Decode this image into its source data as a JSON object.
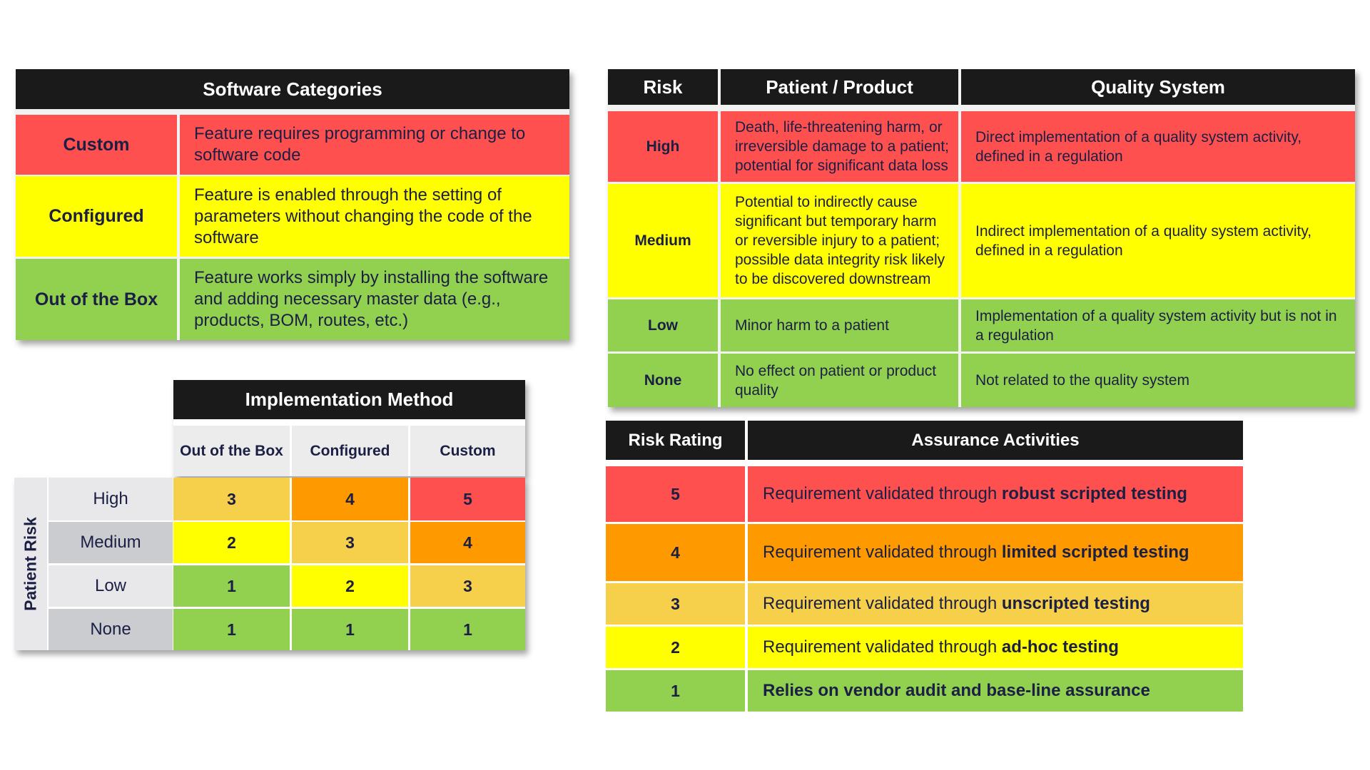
{
  "colors": {
    "header_bg": "#1a1a1a",
    "red": "#ff5050",
    "orange": "#ff9900",
    "light_orange": "#f6cf4b",
    "yellow": "#ffff00",
    "green": "#92d050",
    "text": "#1b1f44",
    "label_light": "#e8e8ea",
    "label_dark": "#cbccd0"
  },
  "software_categories": {
    "title": "Software Categories",
    "rows": [
      {
        "label": "Custom",
        "description": "Feature requires programming or change to software code",
        "color": "#ff5050"
      },
      {
        "label": "Configured",
        "description": "Feature is enabled through the setting of parameters without changing the code of the software",
        "color": "#ffff00"
      },
      {
        "label": "Out of the Box",
        "description": "Feature works simply by installing the software and adding necessary master data (e.g., products, BOM, routes, etc.)",
        "color": "#92d050"
      }
    ]
  },
  "risk_table": {
    "headers": [
      "Risk",
      "Patient / Product",
      "Quality System"
    ],
    "rows": [
      {
        "risk": "High",
        "patient_product": "Death, life-threatening harm, or irreversible damage to a patient; potential for significant data loss",
        "quality_system": "Direct implementation of a quality system activity, defined in a regulation",
        "color": "#ff5050"
      },
      {
        "risk": "Medium",
        "patient_product": "Potential to indirectly cause significant but temporary harm or reversible injury to a patient; possible data integrity risk likely to be discovered downstream",
        "quality_system": "Indirect implementation of a quality system activity, defined in a regulation",
        "color": "#ffff00"
      },
      {
        "risk": "Low",
        "patient_product": "Minor harm to a patient",
        "quality_system": "Implementation of a quality system activity but is not in a regulation",
        "color": "#92d050"
      },
      {
        "risk": "None",
        "patient_product": "No effect on patient or product quality",
        "quality_system": "Not related to the quality system",
        "color": "#92d050"
      }
    ]
  },
  "implementation_matrix": {
    "title": "Implementation Method",
    "side_label": "Patient Risk",
    "columns": [
      "Out of the Box",
      "Configured",
      "Custom"
    ],
    "rows": [
      {
        "label": "High",
        "values": [
          "3",
          "4",
          "5"
        ]
      },
      {
        "label": "Medium",
        "values": [
          "2",
          "3",
          "4"
        ]
      },
      {
        "label": "Low",
        "values": [
          "1",
          "2",
          "3"
        ]
      },
      {
        "label": "None",
        "values": [
          "1",
          "1",
          "1"
        ]
      }
    ]
  },
  "assurance_table": {
    "headers": [
      "Risk Rating",
      "Assurance Activities"
    ],
    "rows": [
      {
        "rating": "5",
        "prefix": "Requirement validated through ",
        "bold": "robust scripted testing",
        "color": "#ff5050"
      },
      {
        "rating": "4",
        "prefix": "Requirement validated through ",
        "bold": "limited scripted testing",
        "color": "#ff9900"
      },
      {
        "rating": "3",
        "prefix": "Requirement validated through ",
        "bold": "unscripted testing",
        "color": "#f6cf4b"
      },
      {
        "rating": "2",
        "prefix": "Requirement validated through ",
        "bold": "ad-hoc testing",
        "color": "#ffff00"
      },
      {
        "rating": "1",
        "prefix": "",
        "bold": "Relies on vendor audit and base-line assurance",
        "color": "#92d050"
      }
    ]
  }
}
